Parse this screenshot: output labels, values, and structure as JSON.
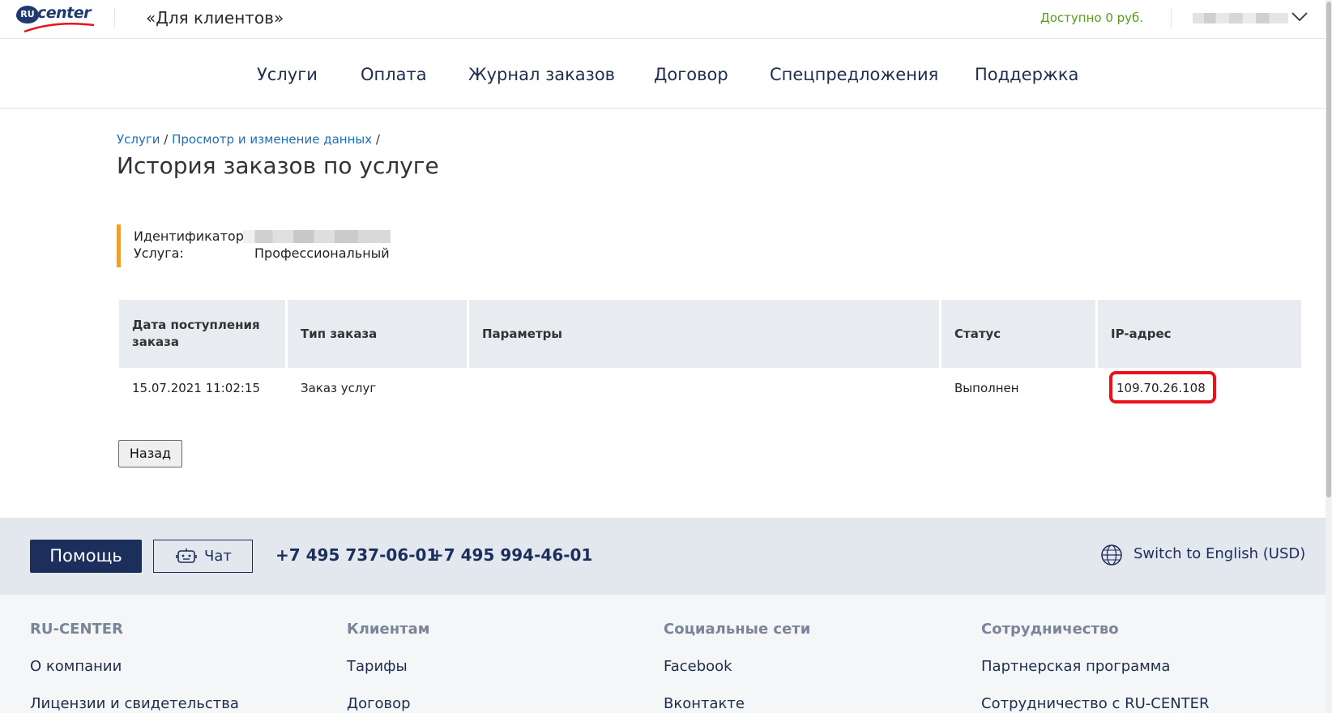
{
  "header": {
    "logo_ru": "RU",
    "logo_center": "center",
    "client_title": "«Для клиентов»",
    "balance": "Доступно 0 руб."
  },
  "nav": [
    "Услуги",
    "Оплата",
    "Журнал заказов",
    "Договор",
    "Спецпредложения",
    "Поддержка"
  ],
  "breadcrumb": {
    "item1": "Услуги",
    "sep1": " / ",
    "item2": "Просмотр и изменение данных",
    "sep2": " /"
  },
  "page_title": "История заказов по услуге",
  "info": {
    "id_label": "Идентификатор",
    "service_label": "Услуга:",
    "service_value": "Профессиональный"
  },
  "table": {
    "headers": [
      "Дата поступления заказа",
      "Тип заказа",
      "Параметры",
      "Статус",
      "IP-адрес"
    ],
    "rows": [
      [
        "15.07.2021 11:02:15",
        "Заказ услуг",
        "",
        "Выполнен",
        "109.70.26.108"
      ]
    ]
  },
  "back_button": "Назад",
  "footer_strip": {
    "help": "Помощь",
    "chat": "Чат",
    "phone1": "+7 495 737-06-01",
    "phone2": "+7 495 994-46-01",
    "lang": "Switch to English (USD)"
  },
  "footer": {
    "columns": [
      {
        "title": "RU-CENTER",
        "links": [
          "О компании",
          "Лицензии и свидетельства"
        ]
      },
      {
        "title": "Клиентам",
        "links": [
          "Тарифы",
          "Договор"
        ]
      },
      {
        "title": "Социальные сети",
        "links": [
          "Facebook",
          "Вконтакте"
        ]
      },
      {
        "title": "Сотрудничество",
        "links": [
          "Партнерская программа",
          "Сотрудничество с RU-CENTER"
        ]
      }
    ]
  },
  "colors": {
    "brand_navy": "#1c2e5c",
    "balance_green": "#5a9b1e",
    "link_blue": "#1d6fb8",
    "accent_orange": "#f0a030",
    "highlight_red": "#e8131b"
  }
}
